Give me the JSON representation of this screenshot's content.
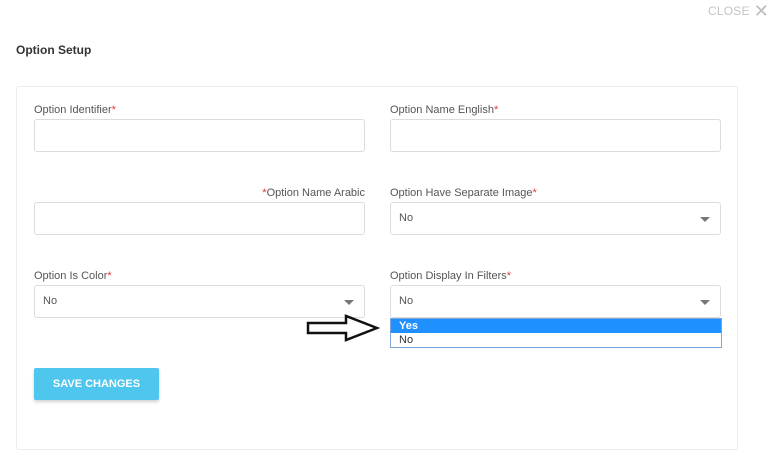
{
  "header": {
    "close_label": "CLOSE",
    "close_icon": "close-icon",
    "title": "Option Setup"
  },
  "form": {
    "identifier_label": "Option Identifier",
    "name_english_label": "Option Name English",
    "name_arabic_label": "Option Name Arabic",
    "separate_image_label": "Option Have Separate Image",
    "separate_image_value": "No",
    "is_color_label": "Option Is Color",
    "is_color_value": "No",
    "display_filters_label": "Option Display In Filters",
    "display_filters_value": "No",
    "required_marker": "*"
  },
  "dropdown": {
    "options": [
      "Yes",
      "No"
    ],
    "highlighted": "Yes"
  },
  "actions": {
    "save_label": "SAVE CHANGES"
  },
  "colors": {
    "accent": "#4fc6ee",
    "highlight": "#1e90ff",
    "required": "#e03a3a"
  }
}
